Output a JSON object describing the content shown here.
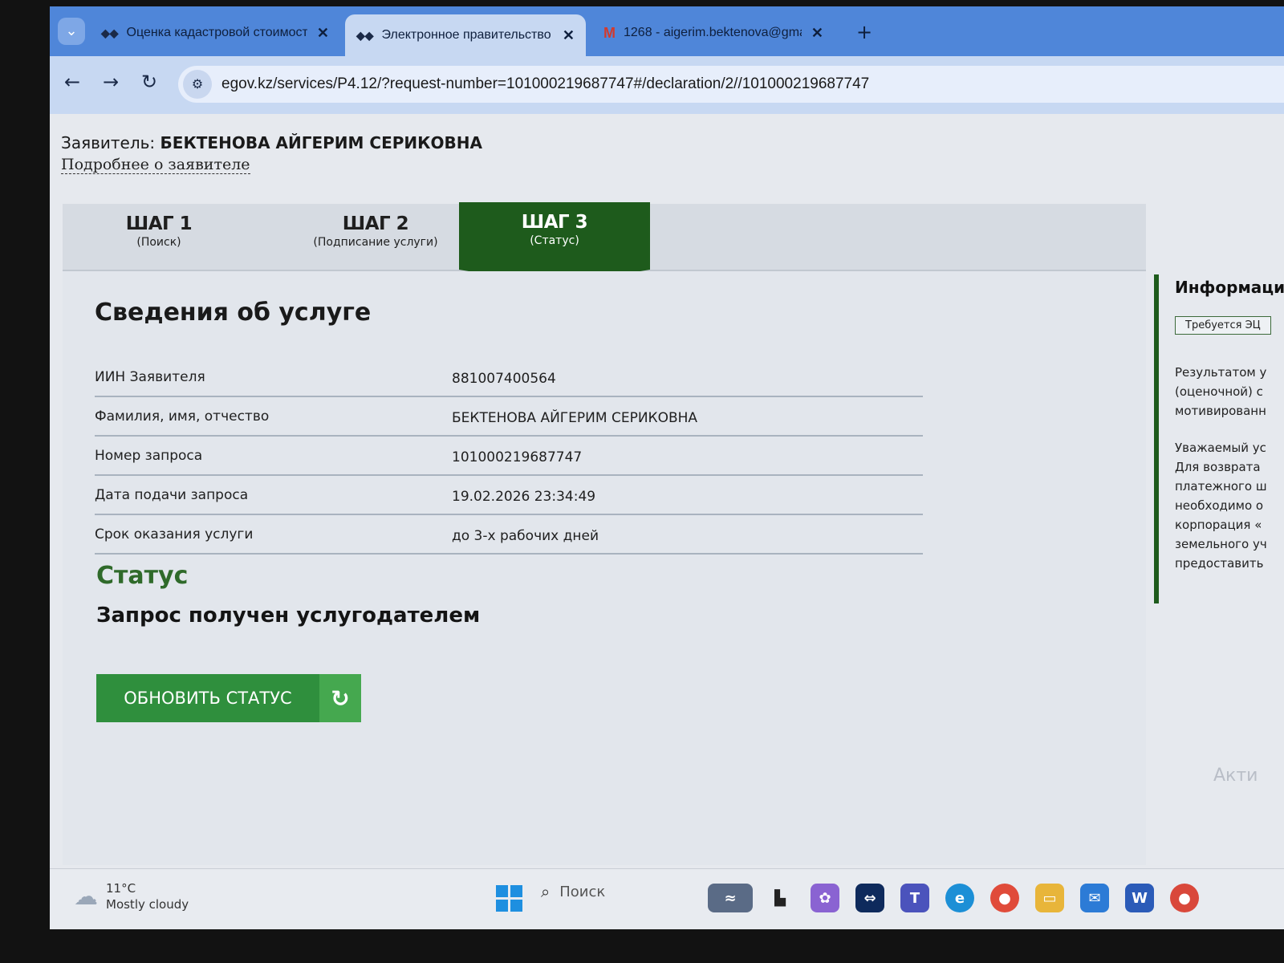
{
  "browser": {
    "tabs": [
      {
        "title": "Оценка кадастровой стоимост",
        "favicon": "egov-icon"
      },
      {
        "title": "Электронное правительство Р",
        "favicon": "egov-icon",
        "active": true
      },
      {
        "title": "1268 - aigerim.bektenova@gma",
        "favicon": "gmail-icon"
      }
    ],
    "url": "egov.kz/services/P4.12/?request-number=101000219687747#/declaration/2//101000219687747"
  },
  "header": {
    "applicant_label": "Заявитель:",
    "applicant_name": "БЕКТЕНОВА АЙГЕРИМ СЕРИКОВНА",
    "more_link": "Подробнее о заявителе"
  },
  "steps": [
    {
      "title": "ШАГ 1",
      "subtitle": "(Поиск)"
    },
    {
      "title": "ШАГ 2",
      "subtitle": "(Подписание услуги)"
    },
    {
      "title": "ШАГ 3",
      "subtitle": "(Статус)",
      "active": true
    }
  ],
  "service": {
    "title": "Сведения об услуге",
    "rows": [
      {
        "label": "ИИН Заявителя",
        "value": "881007400564"
      },
      {
        "label": "Фамилия, имя, отчество",
        "value": "БЕКТЕНОВА АЙГЕРИМ СЕРИКОВНА"
      },
      {
        "label": "Номер запроса",
        "value": "101000219687747"
      },
      {
        "label": "Дата подачи запроса",
        "value": "19.02.2026 23:34:49"
      },
      {
        "label": "Срок оказания услуги",
        "value": "до 3-х рабочих дней"
      }
    ]
  },
  "status": {
    "heading": "Статус",
    "text": "Запрос получен услугодателем",
    "refresh_button": "ОБНОВИТЬ СТАТУС"
  },
  "sidebar": {
    "title": "Информаци",
    "badge": "Требуется ЭЦ",
    "paragraph1": [
      "Результатом у",
      "(оценочной) с",
      "мотивированн"
    ],
    "paragraph2": [
      "Уважаемый ус",
      "Для возврата",
      "платежного ш",
      "необходимо о",
      "корпорация «",
      "земельного уч",
      "предоставить"
    ]
  },
  "watermark": "Акти",
  "taskbar": {
    "temperature": "11°C",
    "weather": "Mostly cloudy",
    "search_placeholder": "Поиск"
  },
  "colors": {
    "active_step": "#1e5b1c",
    "button": "#2f8f3d",
    "status_heading": "#2f6a2a"
  }
}
